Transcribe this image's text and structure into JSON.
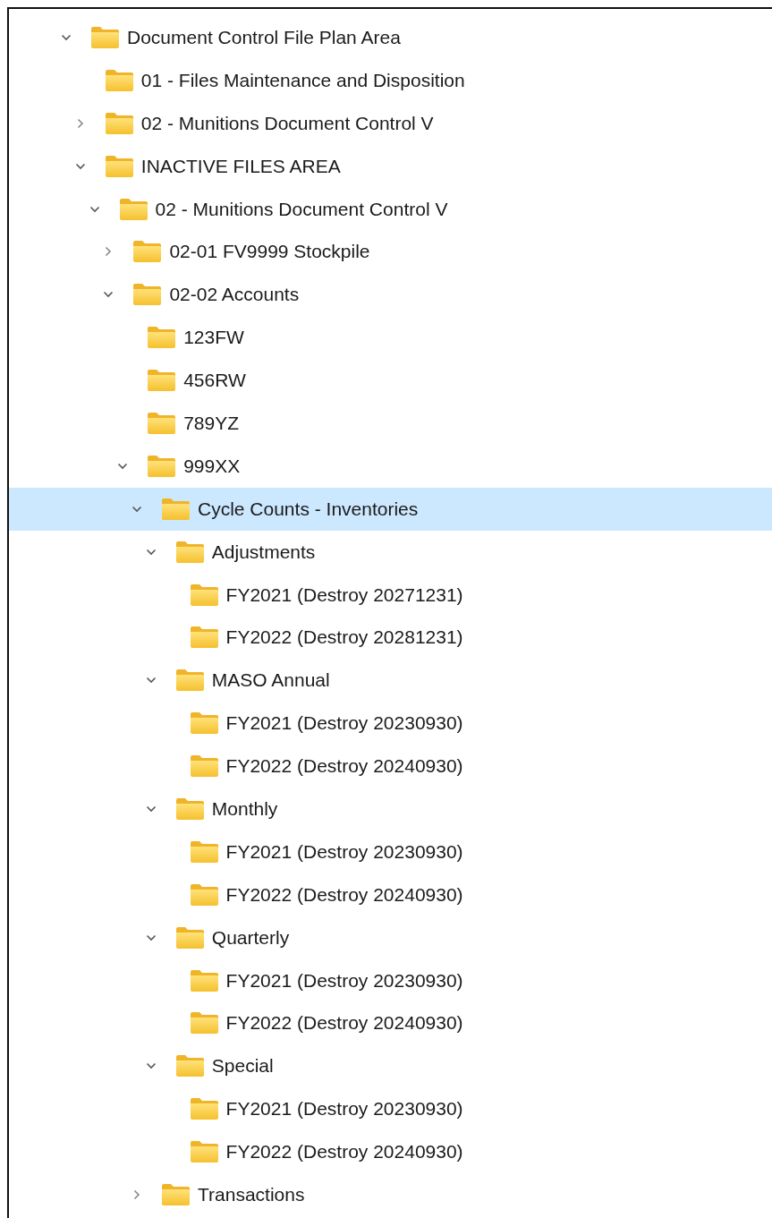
{
  "tree": [
    {
      "label": "Document Control File Plan Area",
      "expanded": true,
      "selected": false,
      "children": [
        {
          "label": "01 - Files Maintenance and Disposition",
          "selected": false
        },
        {
          "label": "02 - Munitions Document Control V",
          "expanded": false,
          "selected": false
        },
        {
          "label": "INACTIVE FILES AREA",
          "expanded": true,
          "selected": false,
          "children": [
            {
              "label": "02 - Munitions Document Control V",
              "expanded": true,
              "selected": false,
              "children": [
                {
                  "label": "02-01 FV9999 Stockpile",
                  "expanded": false,
                  "selected": false
                },
                {
                  "label": "02-02 Accounts",
                  "expanded": true,
                  "selected": false,
                  "children": [
                    {
                      "label": "123FW",
                      "selected": false
                    },
                    {
                      "label": "456RW",
                      "selected": false
                    },
                    {
                      "label": "789YZ",
                      "selected": false
                    },
                    {
                      "label": "999XX",
                      "expanded": true,
                      "selected": false,
                      "children": [
                        {
                          "label": "Cycle Counts - Inventories",
                          "expanded": true,
                          "selected": true,
                          "children": [
                            {
                              "label": "Adjustments",
                              "expanded": true,
                              "selected": false,
                              "children": [
                                {
                                  "label": "FY2021 (Destroy 20271231)",
                                  "selected": false
                                },
                                {
                                  "label": "FY2022 (Destroy 20281231)",
                                  "selected": false
                                }
                              ]
                            },
                            {
                              "label": "MASO Annual",
                              "expanded": true,
                              "selected": false,
                              "children": [
                                {
                                  "label": "FY2021 (Destroy 20230930)",
                                  "selected": false
                                },
                                {
                                  "label": "FY2022 (Destroy 20240930)",
                                  "selected": false
                                }
                              ]
                            },
                            {
                              "label": "Monthly",
                              "expanded": true,
                              "selected": false,
                              "children": [
                                {
                                  "label": "FY2021 (Destroy 20230930)",
                                  "selected": false
                                },
                                {
                                  "label": "FY2022 (Destroy 20240930)",
                                  "selected": false
                                }
                              ]
                            },
                            {
                              "label": "Quarterly",
                              "expanded": true,
                              "selected": false,
                              "children": [
                                {
                                  "label": "FY2021 (Destroy 20230930)",
                                  "selected": false
                                },
                                {
                                  "label": "FY2022 (Destroy 20240930)",
                                  "selected": false
                                }
                              ]
                            },
                            {
                              "label": "Special",
                              "expanded": true,
                              "selected": false,
                              "children": [
                                {
                                  "label": "FY2021 (Destroy 20230930)",
                                  "selected": false
                                },
                                {
                                  "label": "FY2022 (Destroy 20240930)",
                                  "selected": false
                                }
                              ]
                            }
                          ]
                        },
                        {
                          "label": "Transactions",
                          "expanded": false,
                          "selected": false
                        }
                      ]
                    }
                  ]
                }
              ]
            }
          ]
        }
      ]
    }
  ]
}
